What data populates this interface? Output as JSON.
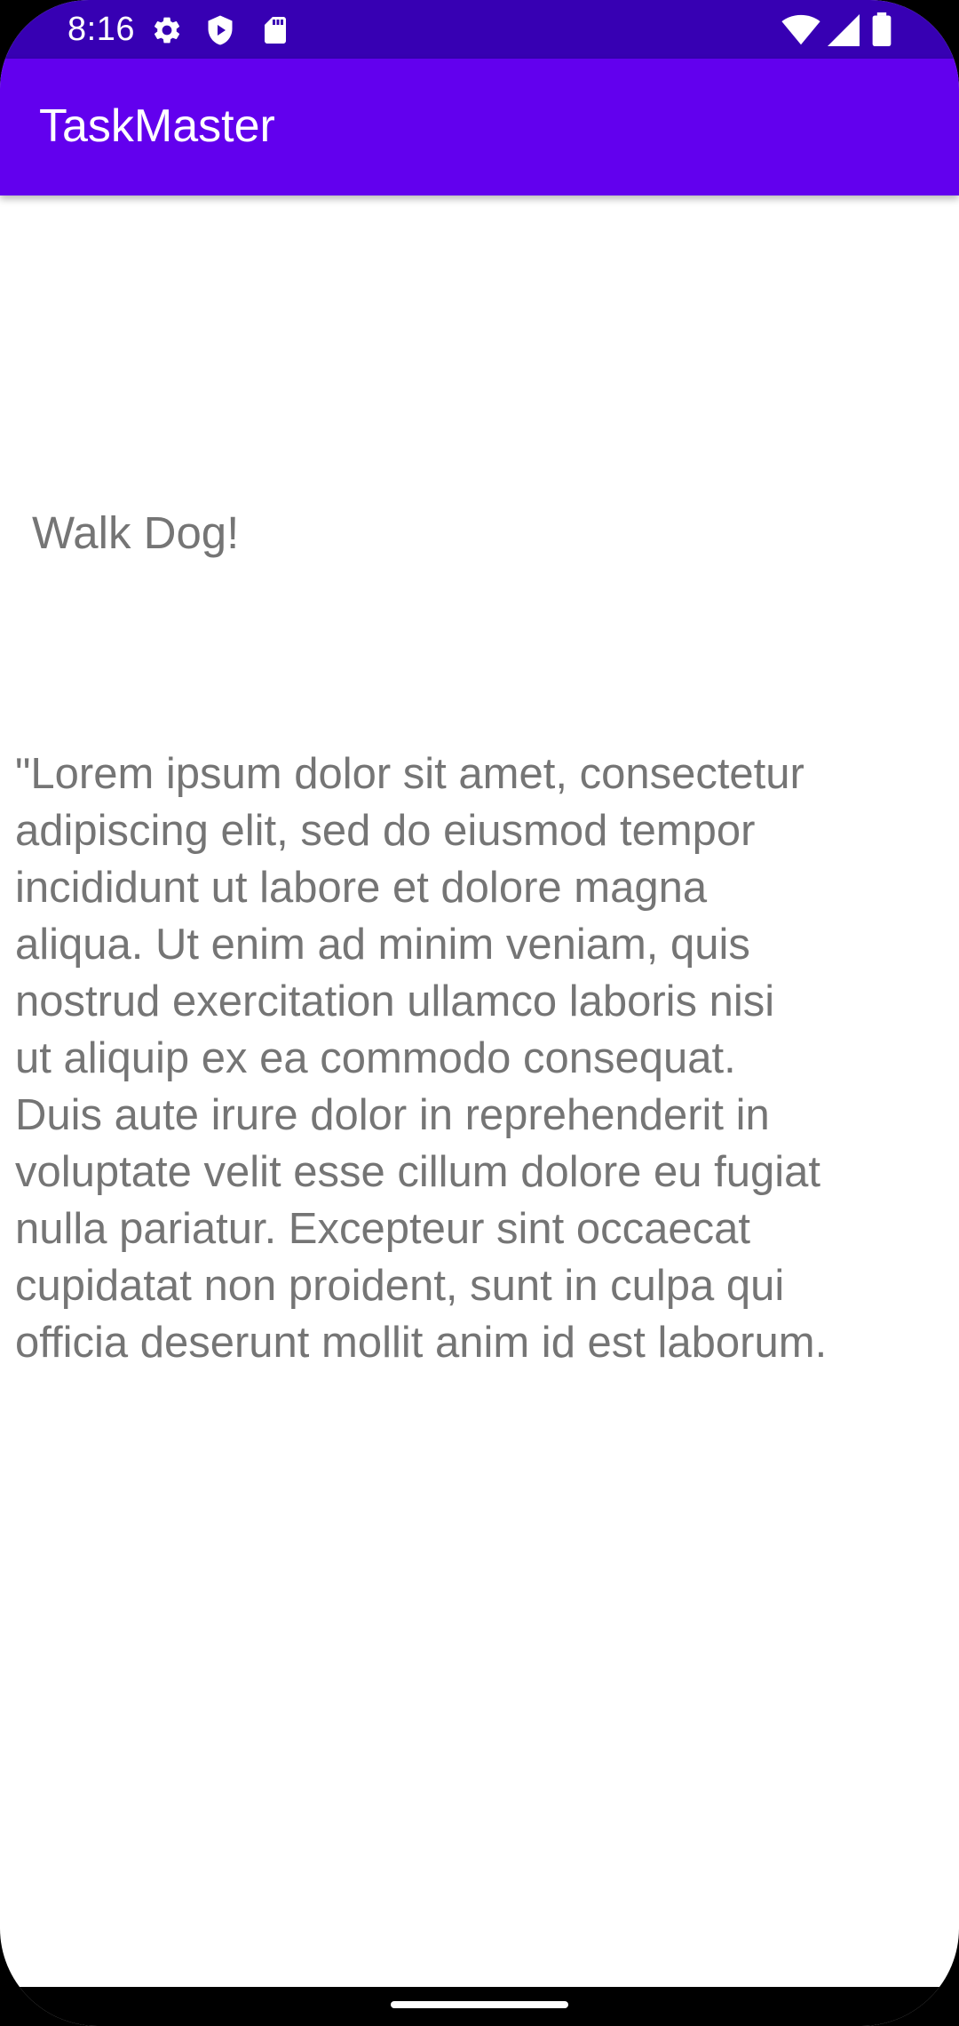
{
  "status_bar": {
    "time": "8:16",
    "left_icons": [
      "settings-icon",
      "shield-play-icon",
      "sd-card-icon"
    ],
    "right_icons": [
      "wifi-icon",
      "cell-signal-icon",
      "battery-icon"
    ]
  },
  "app_bar": {
    "title": "TaskMaster"
  },
  "task": {
    "title": "Walk Dog!",
    "body": "\"Lorem ipsum dolor sit amet, consectetur\nadipiscing elit, sed do eiusmod tempor\nincididunt ut labore et dolore magna\naliqua. Ut enim ad minim veniam, quis\nnostrud exercitation ullamco laboris nisi\nut aliquip ex ea commodo consequat.\nDuis aute irure dolor in reprehenderit in\nvoluptate velit esse cillum dolore eu fugiat\nnulla pariatur. Excepteur sint occaecat\ncupidatat non proident, sunt in culpa qui\nofficia deserunt mollit anim id est laborum."
  },
  "colors": {
    "status_bar": "#3700b3",
    "app_bar": "#6200ee",
    "text_secondary": "#757575"
  }
}
